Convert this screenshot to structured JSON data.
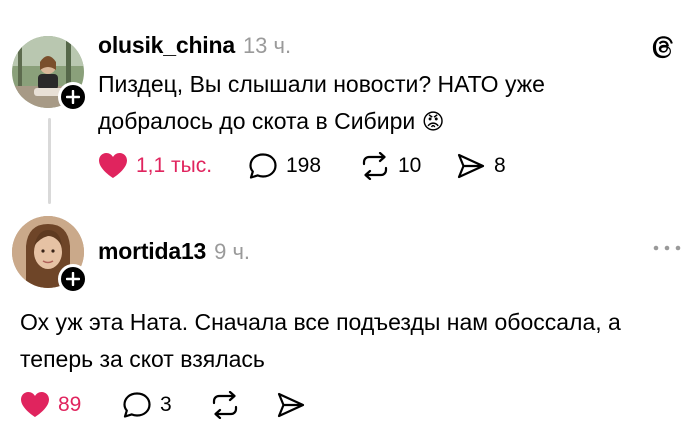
{
  "posts": [
    {
      "username": "olusik_china",
      "time": "13 ч.",
      "text_line1": "Пиздец, Вы слышали новости? НАТО уже",
      "text_line2": "добралось до скота в Сибири",
      "emoji": "😡",
      "likes": "1,1 тыс.",
      "comments": "198",
      "reposts": "10",
      "shares": "8",
      "liked": true
    },
    {
      "username": "mortida13",
      "time": "9 ч.",
      "text_line1": "Ох уж эта Ната. Сначала все подъезды нам обоссала, а",
      "text_line2": "теперь за скот взялась",
      "likes": "89",
      "comments": "3",
      "liked": true
    }
  ],
  "icons": {
    "header": "threads-logo-icon",
    "more": "more-options-icon",
    "like": "heart-icon",
    "comment": "comment-icon",
    "repost": "repost-icon",
    "share": "share-icon",
    "follow": "plus-icon"
  },
  "colors": {
    "like_red": "#e0245e",
    "muted_gray": "#9a9a9a",
    "thread_line": "#d9d9d9"
  }
}
